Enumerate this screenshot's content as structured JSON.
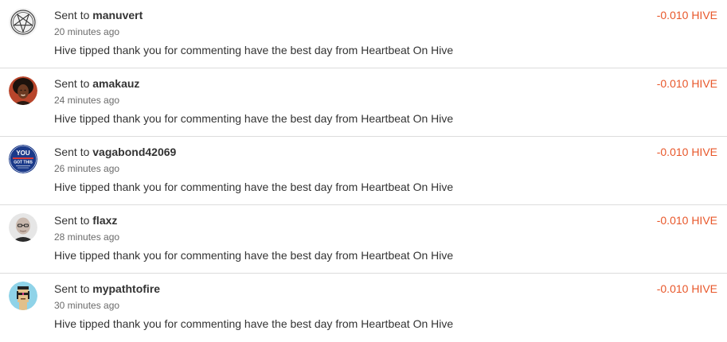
{
  "transactions": [
    {
      "prefix": "Sent to",
      "user": "manuvert",
      "time": "20 minutes ago",
      "memo": "Hive tipped thank you for commenting have the best day from Heartbeat On Hive",
      "amount": "-0.010 HIVE",
      "avatar_icon": "pentagram-avatar-icon"
    },
    {
      "prefix": "Sent to",
      "user": "amakauz",
      "time": "24 minutes ago",
      "memo": "Hive tipped thank you for commenting have the best day from Heartbeat On Hive",
      "amount": "-0.010 HIVE",
      "avatar_icon": "portrait-avatar-icon"
    },
    {
      "prefix": "Sent to",
      "user": "vagabond42069",
      "time": "26 minutes ago",
      "memo": "Hive tipped thank you for commenting have the best day from Heartbeat On Hive",
      "amount": "-0.010 HIVE",
      "avatar_icon": "badge-avatar-icon",
      "avatar_text": [
        "YOU",
        "GOT THIS"
      ]
    },
    {
      "prefix": "Sent to",
      "user": "flaxz",
      "time": "28 minutes ago",
      "memo": "Hive tipped thank you for commenting have the best day from Heartbeat On Hive",
      "amount": "-0.010 HIVE",
      "avatar_icon": "bald-man-avatar-icon"
    },
    {
      "prefix": "Sent to",
      "user": "mypathtofire",
      "time": "30 minutes ago",
      "memo": "Hive tipped thank you for commenting have the best day from Heartbeat On Hive",
      "amount": "-0.010 HIVE",
      "avatar_icon": "pixel-punk-avatar-icon"
    }
  ],
  "colors": {
    "amount": "#e8572a",
    "divider": "#dcdcdc"
  }
}
